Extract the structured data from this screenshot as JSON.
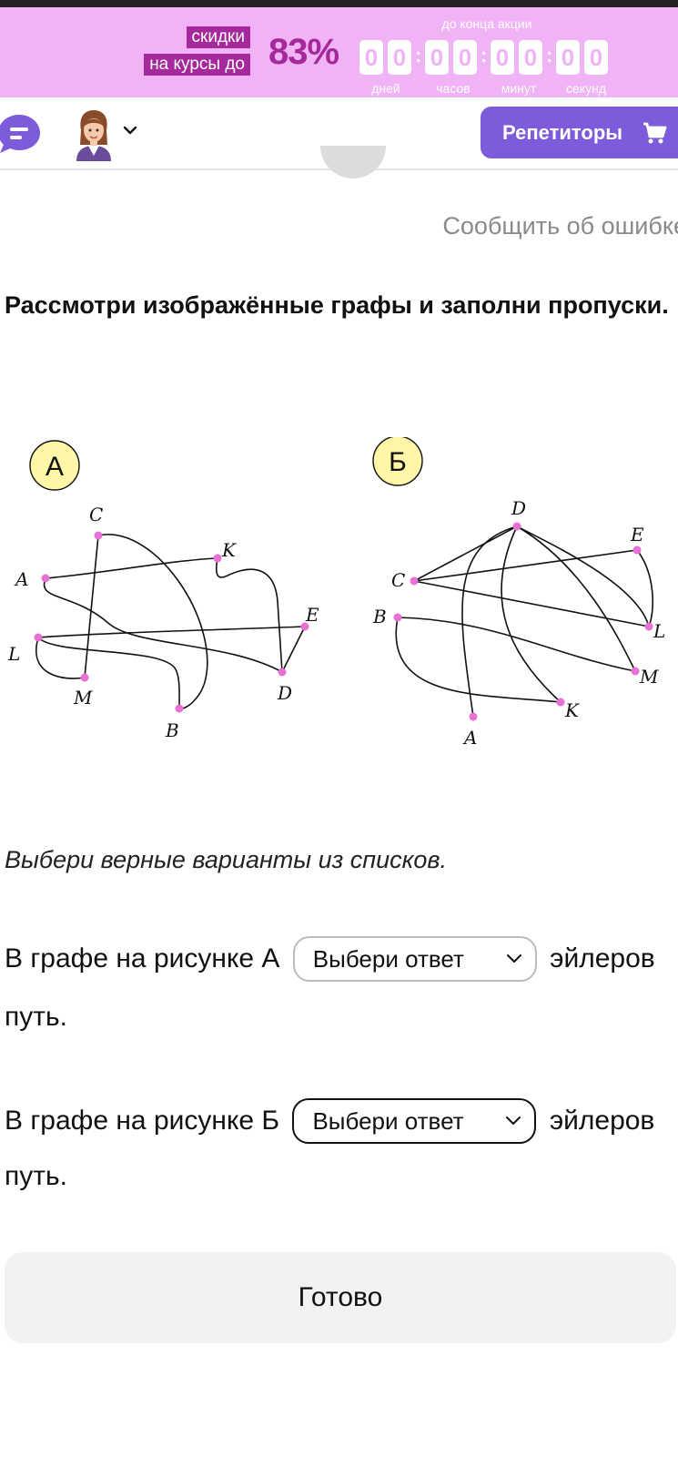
{
  "promo": {
    "tag_line1": "скидки",
    "tag_line2": "на курсы до",
    "percent": "83%",
    "until_label": "до конца акции",
    "digits": [
      "0",
      "0",
      "0",
      "0",
      "0",
      "0",
      "0",
      "0"
    ],
    "units": [
      "дней",
      "часов",
      "минут",
      "секунд"
    ],
    "accent_color": "#a6299c",
    "background_color": "#f0b3f5"
  },
  "navbar": {
    "tutors_label": "Репетиторы",
    "button_color": "#7d5bdb"
  },
  "report_link": "Сообщить об ошибке",
  "question": "Рассмотри изображённые графы и заполни пропуски.",
  "graphs": {
    "a": {
      "badge": "А",
      "vertices": [
        "C",
        "K",
        "A",
        "E",
        "L",
        "M",
        "B",
        "D"
      ]
    },
    "b": {
      "badge": "Б",
      "vertices": [
        "D",
        "E",
        "C",
        "B",
        "L",
        "M",
        "K",
        "A"
      ]
    },
    "badge_color": "#fff6a8",
    "vertex_color": "#e86fd4"
  },
  "instruction": "Выбери верные варианты из списков.",
  "sentence_a": {
    "prefix": "В графе на рисунке А",
    "select_placeholder": "Выбери ответ",
    "suffix": "эйлеров",
    "tail": "путь."
  },
  "sentence_b": {
    "prefix": "В графе на рисунке Б",
    "select_placeholder": "Выбери ответ",
    "suffix": "эйлеров",
    "tail": "путь."
  },
  "done_label": "Готово"
}
